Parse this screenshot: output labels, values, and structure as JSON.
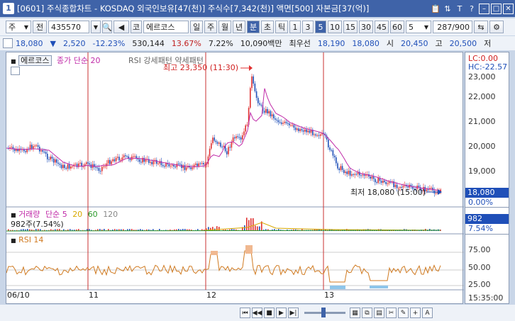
{
  "window": {
    "number": "1",
    "title": "[0601] 주식종합차트 - KOSDAQ 외국인보유[47(천)] 주식수[7,342(천)] 액면[500] 자본금[37(억)]",
    "tool_icons": [
      "📋",
      "⇅",
      "T",
      "?"
    ],
    "win_icons": [
      "–",
      "□",
      "✕"
    ]
  },
  "toolbar": {
    "market": "주",
    "period_mode": "전",
    "code": "435570",
    "sound_icon": "◀",
    "exchange": "코",
    "name": "에르코스",
    "periods": [
      "일",
      "주",
      "월",
      "년",
      "분",
      "초",
      "틱"
    ],
    "active_period": "분",
    "minutes": [
      "1",
      "3",
      "5",
      "10",
      "15",
      "30",
      "45",
      "60"
    ],
    "active_minute": "5",
    "select_value": "5",
    "page": "287/900"
  },
  "info": {
    "price": "18,080",
    "change": "2,520",
    "change_pct": "-12.23%",
    "volume": "530,144",
    "turnover_pct": "13.67%",
    "vol_ratio": "7.22%",
    "amount": "10,090백만",
    "prio_label": "최우선",
    "ask": "18,190",
    "bid": "18,080",
    "open_label": "시",
    "open": "20,450",
    "high_label": "고",
    "high": "20,500",
    "low_label": "저"
  },
  "legend": {
    "price_name": "에르코스",
    "ma": "종가 단순 20",
    "rsi_pattern": "RSI 강세패턴 약세패턴",
    "volume_name": "거래량",
    "volume_ma_label": "단순",
    "volume_mas": [
      "5",
      "20",
      "60",
      "120"
    ],
    "volume_current": "982주(7.54%)",
    "rsi": "RSI 14"
  },
  "annotations": {
    "high": "최고 23,350 (11:30)",
    "low": "최저 18,080 (15:00)"
  },
  "right_axis": {
    "lc": "LC:0.00",
    "hc": "HC:-22.57",
    "price_ticks": [
      "23,000",
      "22,000",
      "21,000",
      "20,000",
      "19,000"
    ],
    "current_price": "18,080",
    "current_pct": "0.00%",
    "volume_value": "982",
    "volume_pct": "7.54%",
    "rsi_ticks": [
      "75.00",
      "50.00",
      "25.00"
    ],
    "time": "15:35:00"
  },
  "x_axis": {
    "labels": [
      "06/10",
      "11",
      "12",
      "13"
    ]
  },
  "colors": {
    "title_bg": "#3f63a8",
    "up": "#e03030",
    "down": "#1f4fb8",
    "ma": "#c02aa8",
    "rsi": "#d07a20",
    "divider": "#c83232"
  }
}
